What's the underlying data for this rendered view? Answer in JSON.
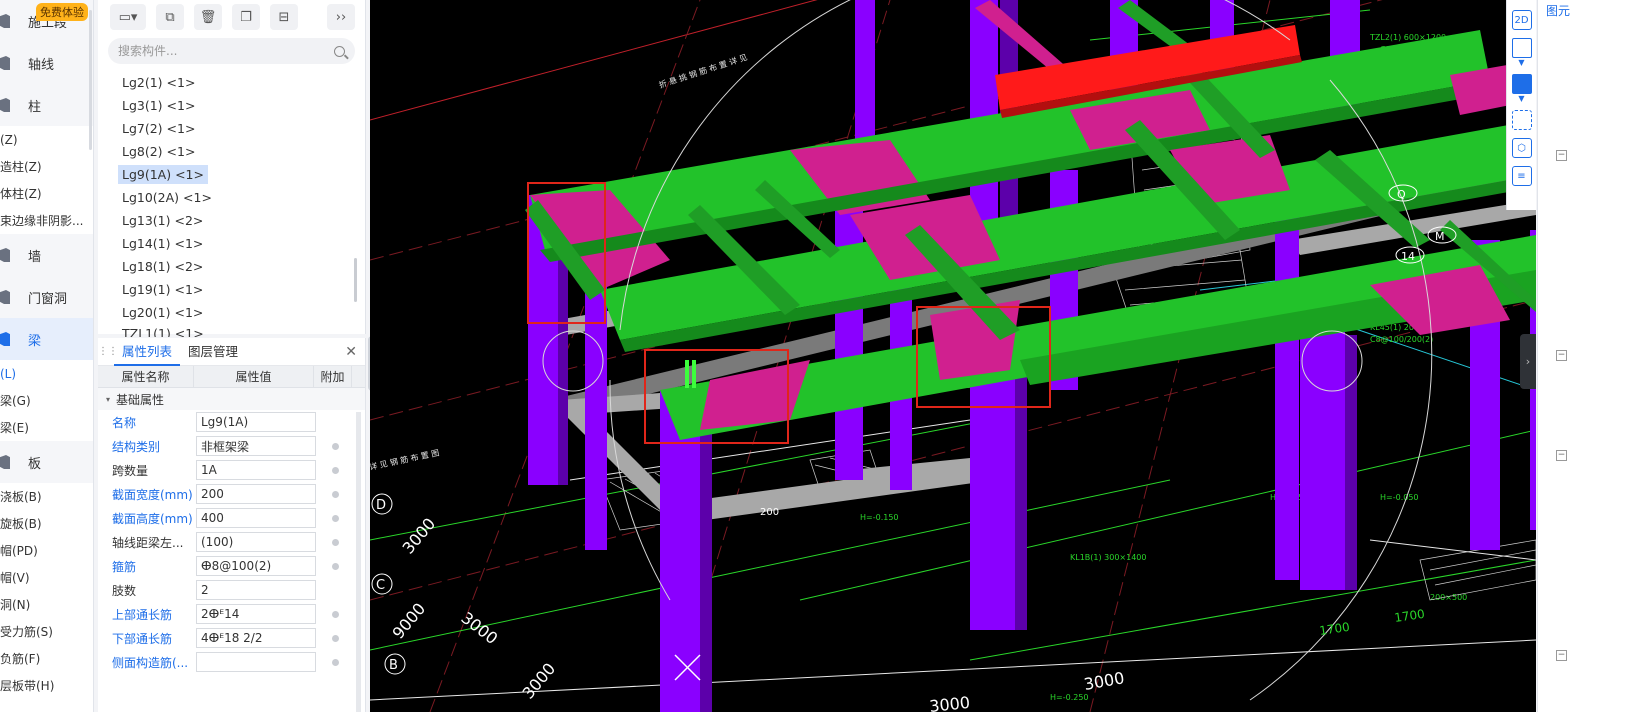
{
  "nav": {
    "trial_badge": "免费体验",
    "rows": [
      {
        "type": "cat",
        "label": "施工段",
        "active": false
      },
      {
        "type": "cat",
        "label": "轴线",
        "active": false
      },
      {
        "type": "cat",
        "label": "柱",
        "active": false
      },
      {
        "type": "sub",
        "label": "柱(Z)",
        "active": false
      },
      {
        "type": "sub",
        "label": "构造柱(Z)",
        "active": false
      },
      {
        "type": "sub",
        "label": "砌体柱(Z)",
        "active": false
      },
      {
        "type": "sub",
        "label": "约束边缘非阴影...",
        "active": false
      },
      {
        "type": "cat",
        "label": "墙",
        "active": false
      },
      {
        "type": "cat",
        "label": "门窗洞",
        "active": false
      },
      {
        "type": "cat",
        "label": "梁",
        "active": true
      },
      {
        "type": "sub",
        "label": "梁(L)",
        "active": true
      },
      {
        "type": "sub",
        "label": "连梁(G)",
        "active": false
      },
      {
        "type": "sub",
        "label": "圈梁(E)",
        "active": false
      },
      {
        "type": "cat",
        "label": "板",
        "active": false
      },
      {
        "type": "sub",
        "label": "现浇板(B)",
        "active": false
      },
      {
        "type": "sub",
        "label": "螺旋板(B)",
        "active": false
      },
      {
        "type": "sub",
        "label": "柱帽(PD)",
        "active": false
      },
      {
        "type": "sub",
        "label": "板帽(V)",
        "active": false
      },
      {
        "type": "sub",
        "label": "板洞(N)",
        "active": false
      },
      {
        "type": "sub",
        "label": "板受力筋(S)",
        "active": false
      },
      {
        "type": "sub",
        "label": "板负筋(F)",
        "active": false
      },
      {
        "type": "sub",
        "label": "楼层板带(H)",
        "active": false
      }
    ]
  },
  "component": {
    "search_placeholder": "搜索构件...",
    "items": [
      "Lg2(1) <1>",
      "Lg3(1) <1>",
      "Lg7(2) <1>",
      "Lg8(2) <1>",
      "Lg9(1A) <1>",
      "Lg10(2A) <1>",
      "Lg13(1) <2>",
      "Lg14(1) <1>",
      "Lg18(1) <2>",
      "Lg19(1) <1>",
      "Lg20(1) <1>",
      "TZL1(1) <1>"
    ],
    "selected_index": 4
  },
  "properties": {
    "tab_active": "属性列表",
    "tab_other": "图层管理",
    "col_name": "属性名称",
    "col_value": "属性值",
    "col_extra": "附加",
    "group": "基础属性",
    "rows": [
      {
        "name": "名称",
        "value": "Lg9(1A)",
        "blue": true,
        "dot": false
      },
      {
        "name": "结构类别",
        "value": "非框架梁",
        "blue": true,
        "dot": true
      },
      {
        "name": "跨数量",
        "value": "1A",
        "blue": false,
        "dot": true
      },
      {
        "name": "截面宽度(mm)",
        "value": "200",
        "blue": true,
        "dot": true
      },
      {
        "name": "截面高度(mm)",
        "value": "400",
        "blue": true,
        "dot": true
      },
      {
        "name": "轴线距梁左...",
        "value": "(100)",
        "blue": false,
        "dot": true
      },
      {
        "name": "箍筋",
        "value": "ⴲ8@100(2)",
        "blue": true,
        "dot": true
      },
      {
        "name": "肢数",
        "value": "2",
        "blue": false,
        "dot": false
      },
      {
        "name": "上部通长筋",
        "value": "2ⴲᴱ14",
        "blue": true,
        "dot": true
      },
      {
        "name": "下部通长筋",
        "value": "4ⴲᴱ18 2/2",
        "blue": true,
        "dot": true
      },
      {
        "name": "侧面构造筋(...",
        "value": "",
        "blue": true,
        "dot": true
      }
    ]
  },
  "viewport": {
    "labels": {
      "axis_d": "D",
      "axis_c": "C",
      "axis_b": "B",
      "dim1": "3000",
      "dim2": "3000",
      "dim3": "9000",
      "dim4": "3000",
      "dim5": "3000",
      "dim6": "3000",
      "dim7": "1700",
      "dim8": "1700",
      "dim9": "200",
      "grid_q": "Q",
      "grid_14": "14",
      "grid_m": "M"
    },
    "colors": {
      "column": "#8a00ff",
      "beam_green": "#22c22a",
      "beam_magenta": "#d0208f",
      "slab_gray": "#a8a8a8",
      "highlight_red": "#ff1a1a",
      "selection_box": "#e0261a"
    }
  },
  "view_toolbar": {
    "btn_2d": "2D",
    "icons": [
      "2d-icon",
      "3d-view-icon",
      "solid-view-icon",
      "fit-view-icon",
      "3d-box-icon",
      "layer-settings-icon"
    ]
  },
  "right_panel": {
    "title": "图元"
  }
}
